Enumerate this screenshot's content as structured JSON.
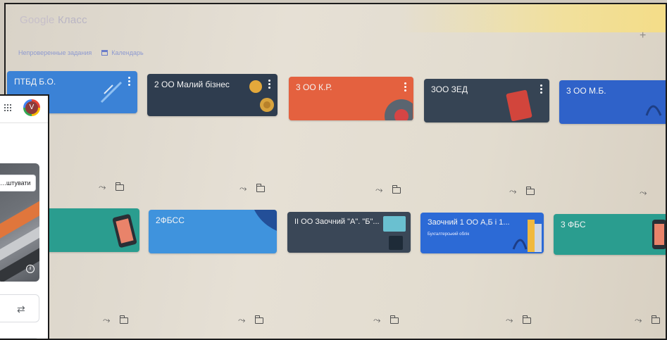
{
  "app": {
    "logo_google": "Google",
    "logo_product": "Класс"
  },
  "header": {
    "plus": "+"
  },
  "subnav": {
    "todo": "Непроверенные задания",
    "calendar": "Календарь"
  },
  "classes": [
    {
      "title": "ПТБД Б.О.",
      "subtitle": "",
      "color": "#3b82d6"
    },
    {
      "title": "2 ОО Малий бізнес",
      "subtitle": "",
      "color": "#2f3d4f"
    },
    {
      "title": "3 ОО К.Р.",
      "subtitle": "",
      "color": "#e4613f"
    },
    {
      "title": "3ОО ЗЕД",
      "subtitle": "",
      "color": "#364454"
    },
    {
      "title": "3 ОО М.Б.",
      "subtitle": "",
      "color": "#2f62c9"
    },
    {
      "title": "",
      "subtitle": "",
      "color": "#2a9d8f"
    },
    {
      "title": "2ФБСС",
      "subtitle": "",
      "color": "#3f93dd"
    },
    {
      "title": "ІІ ОО Заочний \"А\". \"Б\"...",
      "subtitle": "",
      "color": "#3a4757"
    },
    {
      "title": "Заочний 1 ОО А,Б і 1...",
      "subtitle": "Бухгалтерський облік",
      "color": "#2c6ad6"
    },
    {
      "title": "3 ФБС",
      "subtitle": "",
      "color": "#2a9d8f"
    }
  ],
  "card_actions": {
    "trend_icon": "trending-icon",
    "folder_icon": "folder-icon",
    "trend_glyph": "⤳"
  },
  "overlay": {
    "avatar_letter": "V",
    "banner_button": "…штувати",
    "info_glyph": "i",
    "swap_glyph": "⇄"
  }
}
